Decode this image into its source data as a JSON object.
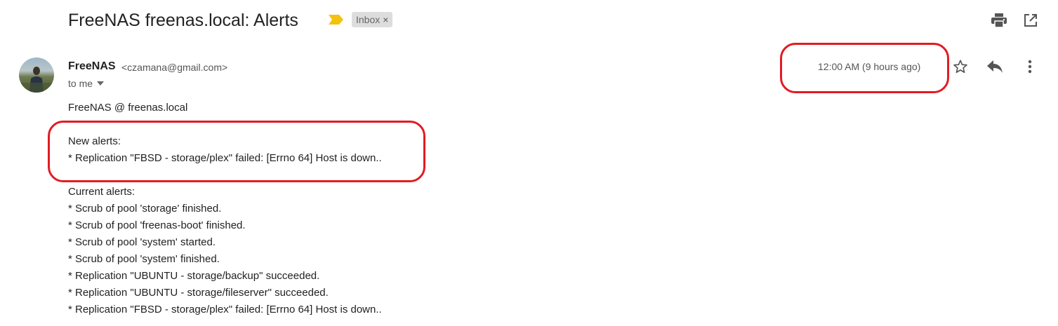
{
  "email": {
    "subject": "FreeNAS freenas.local: Alerts",
    "label": "Inbox",
    "label_remove": "×",
    "sender_name": "FreeNAS",
    "sender_email": "<czamana@gmail.com>",
    "recipient": "to me",
    "timestamp": "12:00 AM (9 hours ago)",
    "body": {
      "greeting": "FreeNAS @ freenas.local",
      "new_alerts_heading": "New alerts:",
      "new_alerts": [
        "* Replication \"FBSD - storage/plex\" failed: [Errno 64] Host is down.."
      ],
      "current_alerts_heading": "Current alerts:",
      "current_alerts": [
        "* Scrub of pool 'storage' finished.",
        "* Scrub of pool 'freenas-boot' finished.",
        "* Scrub of pool 'system' started.",
        "* Scrub of pool 'system' finished.",
        "* Replication \"UBUNTU - storage/backup\" succeeded.",
        "* Replication \"UBUNTU - storage/fileserver\" succeeded.",
        "* Replication \"FBSD - storage/plex\" failed: [Errno 64] Host is down.."
      ]
    }
  },
  "icons": {
    "importance": "importance-marker-icon",
    "print": "print-icon",
    "open_new_window": "open-in-new-window-icon",
    "star": "star-icon",
    "reply": "reply-icon",
    "more": "more-vertical-icon",
    "recipient_dropdown": "caret-down-icon"
  },
  "colors": {
    "annotation": "#e21b23",
    "importance_marker": "#f4c20d",
    "label_chip_bg": "#dddddd"
  }
}
